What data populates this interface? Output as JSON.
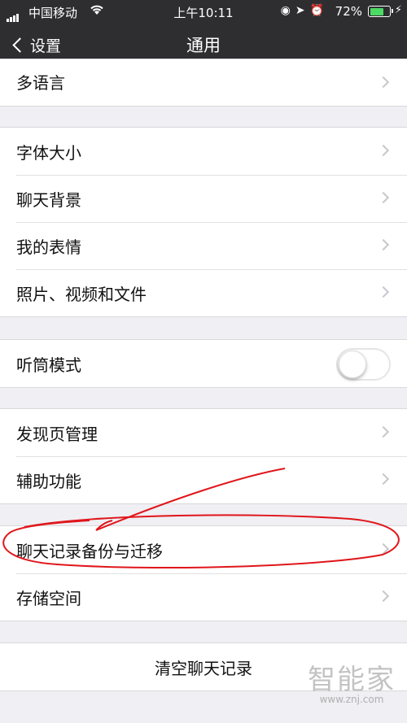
{
  "status_bar": {
    "carrier": "中国移动",
    "time": "上午10:11",
    "battery_percent": "72%",
    "battery_level": 0.72,
    "icons": [
      "signal-icon",
      "wifi-icon",
      "rotation-lock-icon",
      "location-icon",
      "alarm-icon",
      "battery-icon",
      "charging-icon"
    ]
  },
  "nav": {
    "back_label": "设置",
    "title": "通用"
  },
  "groups": [
    {
      "items": [
        {
          "label": "多语言",
          "type": "arrow"
        }
      ]
    },
    {
      "items": [
        {
          "label": "字体大小",
          "type": "arrow"
        },
        {
          "label": "聊天背景",
          "type": "arrow"
        },
        {
          "label": "我的表情",
          "type": "arrow"
        },
        {
          "label": "照片、视频和文件",
          "type": "arrow"
        }
      ]
    },
    {
      "items": [
        {
          "label": "听筒模式",
          "type": "toggle",
          "on": false
        }
      ]
    },
    {
      "items": [
        {
          "label": "发现页管理",
          "type": "arrow"
        },
        {
          "label": "辅助功能",
          "type": "arrow"
        }
      ]
    },
    {
      "items": [
        {
          "label": "聊天记录备份与迁移",
          "type": "arrow",
          "highlighted": true
        },
        {
          "label": "存储空间",
          "type": "arrow"
        }
      ]
    },
    {
      "items": [
        {
          "label": "清空聊天记录",
          "type": "button"
        }
      ]
    }
  ],
  "watermark": {
    "logo_text": "智能家",
    "url": "www.znj.com"
  },
  "colors": {
    "header_bg": "#2e2e31",
    "page_bg": "#efeff4",
    "annotation": "#e0161b",
    "battery_fill": "#4cd964"
  }
}
